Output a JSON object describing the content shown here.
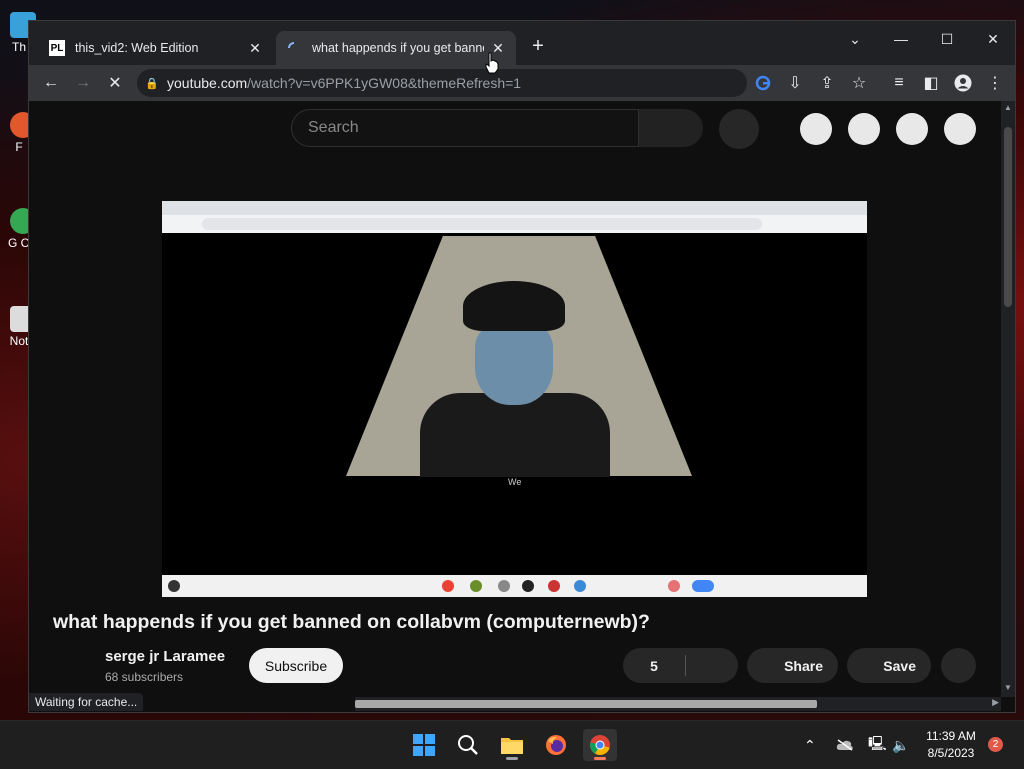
{
  "desktop": {
    "icons": [
      {
        "label": "Th",
        "color": "#3aa0d8"
      },
      {
        "label": "F",
        "color": "#e2572c"
      },
      {
        "label": "G Ch",
        "color": "#34a853"
      },
      {
        "label": "Not",
        "color": "#dcdcdc"
      }
    ]
  },
  "browser": {
    "tabs": [
      {
        "title": "this_vid2: Web Edition",
        "favicon": "PL",
        "active": false
      },
      {
        "title": "what happends if you get banned on collabvm",
        "favicon": "loading-spinner",
        "active": true
      }
    ],
    "new_tab_label": "+",
    "url_host": "youtube.com",
    "url_rest": "/watch?v=v6PPK1yGW08&themeRefresh=1",
    "status_text": "Waiting for cache..."
  },
  "youtube": {
    "search_placeholder": "Search",
    "video_title": "what happends if you get banned on collabvm (computernewb)?",
    "channel_name": "serge jr Laramee",
    "subscribers": "68 subscribers",
    "subscribe_label": "Subscribe",
    "like_count": "5",
    "share_label": "Share",
    "save_label": "Save",
    "video_caption": "We"
  },
  "taskbar": {
    "time": "11:39 AM",
    "date": "8/5/2023",
    "notification_count": "2"
  },
  "colors": {
    "yt_bg": "#0f0f0f",
    "chrome_toolbar": "#35363a",
    "chrome_tabstrip": "#202124",
    "notif_badge": "#e05a4a"
  }
}
